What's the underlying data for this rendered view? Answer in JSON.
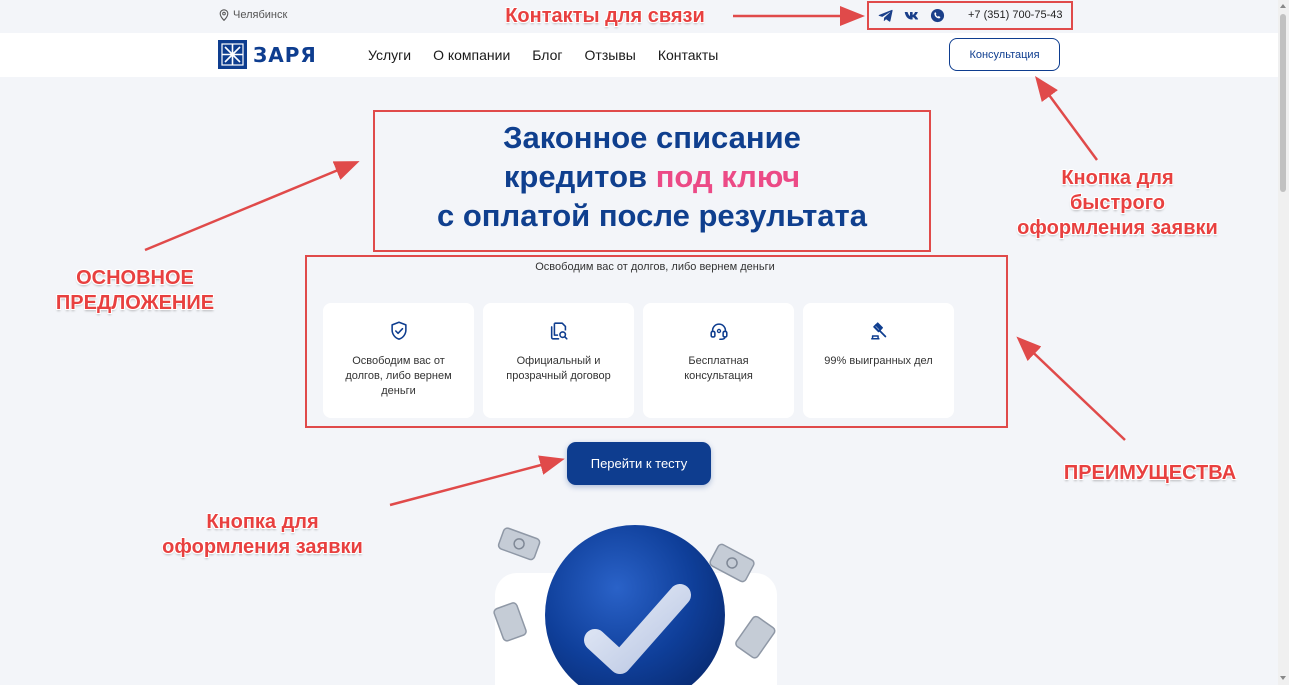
{
  "topbar": {
    "city": "Челябинск",
    "phone": "+7 (351) 700-75-43",
    "social_icons": [
      "telegram-icon",
      "vk-icon",
      "whatsapp-icon"
    ]
  },
  "header": {
    "logo_text": "ЗАРЯ",
    "nav": [
      "Услуги",
      "О компании",
      "Блог",
      "Отзывы",
      "Контакты"
    ],
    "consult_button": "Консультация"
  },
  "hero": {
    "title_line1": "Законное списание",
    "title_line2_a": "кредитов",
    "title_line2_accent": "под ключ",
    "title_line3": "с оплатой после результата",
    "subtitle": "Освободим вас от долгов, либо вернем деньги",
    "cards": [
      {
        "icon": "shield-check-icon",
        "text": "Освободим вас от долгов, либо вернем деньги"
      },
      {
        "icon": "document-search-icon",
        "text": "Официальный и прозрачный договор"
      },
      {
        "icon": "headset-icon",
        "text": "Бесплатная консультация"
      },
      {
        "icon": "gavel-icon",
        "text": "99% выигранных дел"
      }
    ],
    "cta_button": "Перейти к тесту"
  },
  "annotations": {
    "contacts": "Контакты для связи",
    "quick_button_1": "Кнопка для",
    "quick_button_2": "быстрого",
    "quick_button_3": "оформления заявки",
    "offer_1": "ОСНОВНОЕ",
    "offer_2": "ПРЕДЛОЖЕНИЕ",
    "advantages": "ПРЕИМУЩЕСТВА",
    "cta_1": "Кнопка для",
    "cta_2": "оформления заявки"
  },
  "colors": {
    "brand": "#0e3d8f",
    "accent": "#ec4a86",
    "annotation": "#e04a4a",
    "page_bg": "#f3f5f9"
  }
}
